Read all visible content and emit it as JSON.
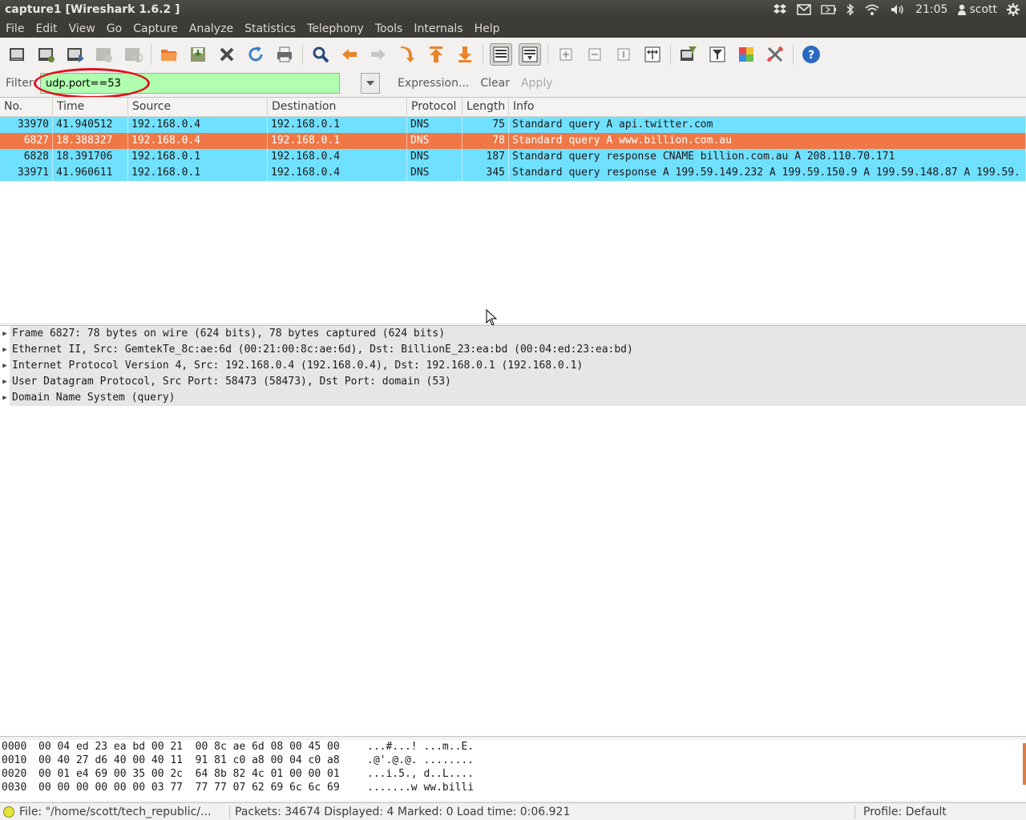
{
  "window": {
    "title": "capture1   [Wireshark 1.6.2 ]",
    "clock": "21:05",
    "user": "scott"
  },
  "menu": [
    "File",
    "Edit",
    "View",
    "Go",
    "Capture",
    "Analyze",
    "Statistics",
    "Telephony",
    "Tools",
    "Internals",
    "Help"
  ],
  "filter": {
    "label": "Filter:",
    "value": "udp.port==53",
    "expression": "Expression...",
    "clear": "Clear",
    "apply": "Apply"
  },
  "columns": [
    "No.",
    "Time",
    "Source",
    "Destination",
    "Protocol",
    "Length",
    "Info"
  ],
  "colors": {
    "dns_row": "#70e0ff",
    "selected_row": "#f07746",
    "filter_ok": "#afffaf",
    "annotation": "#e0101a"
  },
  "packets": [
    {
      "no": "33970",
      "time": "41.940512",
      "src": "192.168.0.4",
      "dst": "192.168.0.1",
      "proto": "DNS",
      "len": "75",
      "info": "Standard query A api.twitter.com",
      "selected": false
    },
    {
      "no": "6827",
      "time": "18.388327",
      "src": "192.168.0.4",
      "dst": "192.168.0.1",
      "proto": "DNS",
      "len": "78",
      "info": "Standard query A www.billion.com.au",
      "selected": true
    },
    {
      "no": "6828",
      "time": "18.391706",
      "src": "192.168.0.1",
      "dst": "192.168.0.4",
      "proto": "DNS",
      "len": "187",
      "info": "Standard query response CNAME billion.com.au A 208.110.70.171",
      "selected": false
    },
    {
      "no": "33971",
      "time": "41.960611",
      "src": "192.168.0.1",
      "dst": "192.168.0.4",
      "proto": "DNS",
      "len": "345",
      "info": "Standard query response A 199.59.149.232 A 199.59.150.9 A 199.59.148.87 A 199.59.",
      "selected": false
    }
  ],
  "details": [
    "Frame 6827: 78 bytes on wire (624 bits), 78 bytes captured (624 bits)",
    "Ethernet II, Src: GemtekTe_8c:ae:6d (00:21:00:8c:ae:6d), Dst: BillionE_23:ea:bd (00:04:ed:23:ea:bd)",
    "Internet Protocol Version 4, Src: 192.168.0.4 (192.168.0.4), Dst: 192.168.0.1 (192.168.0.1)",
    "User Datagram Protocol, Src Port: 58473 (58473), Dst Port: domain (53)",
    "Domain Name System (query)"
  ],
  "hex": [
    {
      "offset": "0000",
      "bytes": "00 04 ed 23 ea bd 00 21  00 8c ae 6d 08 00 45 00",
      "ascii": "...#...! ...m..E."
    },
    {
      "offset": "0010",
      "bytes": "00 40 27 d6 40 00 40 11  91 81 c0 a8 00 04 c0 a8",
      "ascii": ".@'.@.@. ........"
    },
    {
      "offset": "0020",
      "bytes": "00 01 e4 69 00 35 00 2c  64 8b 82 4c 01 00 00 01",
      "ascii": "...i.5., d..L...."
    },
    {
      "offset": "0030",
      "bytes": "00 00 00 00 00 00 03 77  77 77 07 62 69 6c 6c 69",
      "ascii": ".......w ww.billi"
    }
  ],
  "status": {
    "file": "File: \"/home/scott/tech_republic/...",
    "packets": "Packets: 34674 Displayed: 4 Marked: 0 Load time: 0:06.921",
    "profile": "Profile: Default"
  }
}
